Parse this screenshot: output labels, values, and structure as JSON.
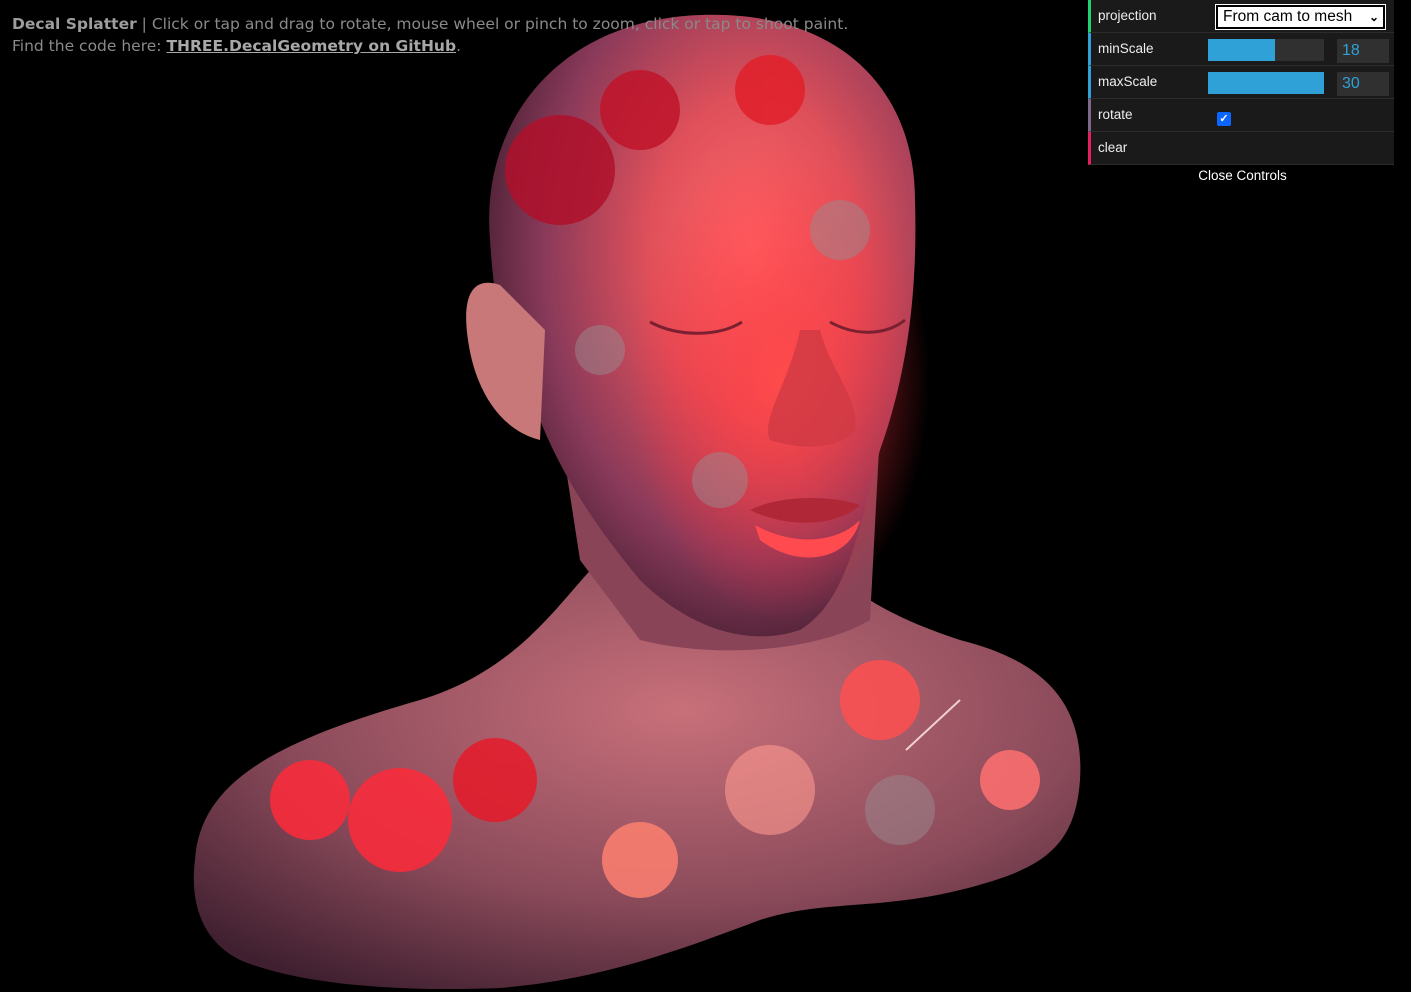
{
  "info": {
    "title": "Decal Splatter",
    "separator": " | ",
    "instructions": "Click or tap and drag to rotate, mouse wheel or pinch to zoom, click or tap to shoot paint.",
    "find_prefix": "Find the code here: ",
    "link_text": "THREE.DecalGeometry on GitHub",
    "find_suffix": "."
  },
  "gui": {
    "projection": {
      "label": "projection",
      "value": "From cam to mesh"
    },
    "minScale": {
      "label": "minScale",
      "value": "18",
      "fraction": 0.58
    },
    "maxScale": {
      "label": "maxScale",
      "value": "30",
      "fraction": 1.0
    },
    "rotate": {
      "label": "rotate",
      "checked": true
    },
    "clear": {
      "label": "clear"
    },
    "close_label": "Close Controls"
  },
  "colors": {
    "slider_fill": "#2fa1d6",
    "background": "#000000"
  }
}
